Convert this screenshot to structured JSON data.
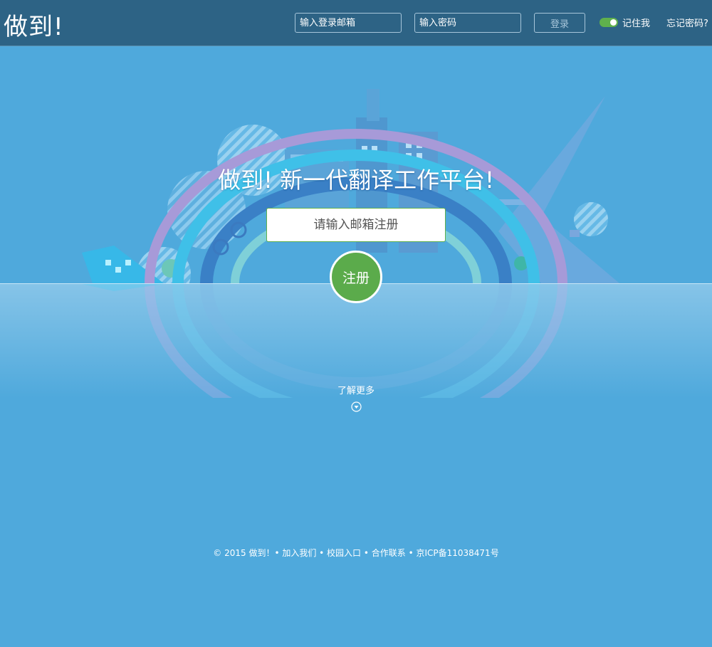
{
  "header": {
    "logo": "做到!",
    "email_placeholder": "输入登录邮箱",
    "password_placeholder": "输入密码",
    "login_label": "登录",
    "remember_label": "记住我",
    "forgot_label": "忘记密码?"
  },
  "hero": {
    "headline": "做到! 新一代翻译工作平台!",
    "register_placeholder": "请输入邮箱注册",
    "register_button": "注册"
  },
  "more": {
    "label": "了解更多",
    "icon": "chevron-down-circle-icon"
  },
  "footer": {
    "text": "© 2015 做到！• 加入我们 • 校园入口 • 合作联系 • 京ICP备11038471号"
  },
  "colors": {
    "header_bg": "#2d6385",
    "page_bg": "#4fa9dc",
    "accent_green": "#5bab4b"
  }
}
